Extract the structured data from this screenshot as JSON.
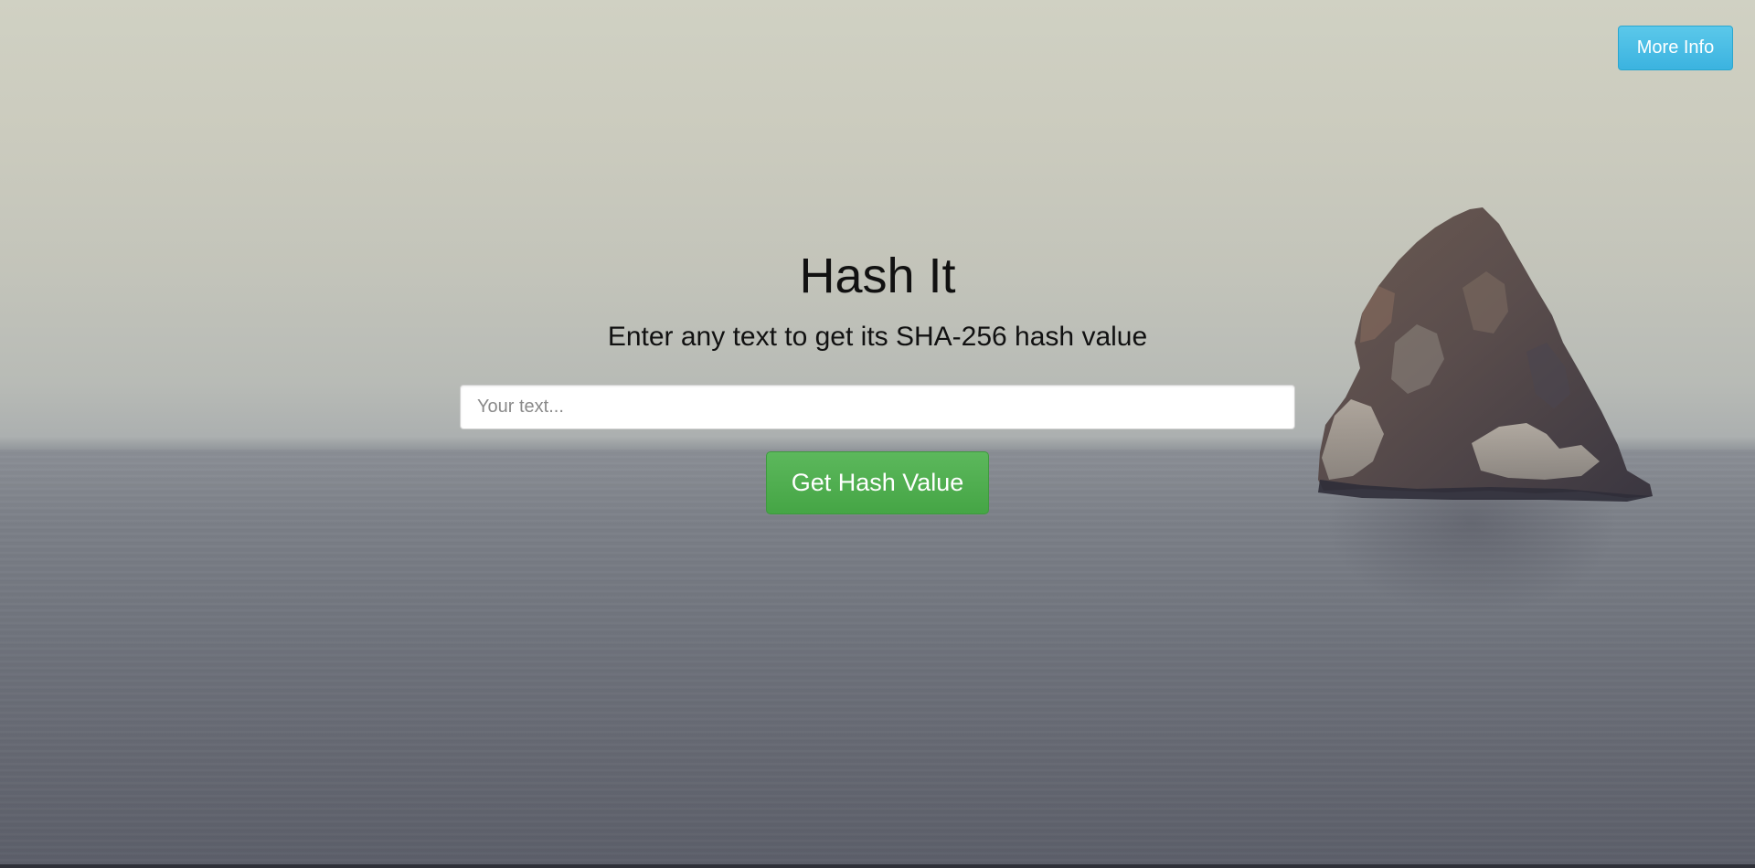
{
  "header": {
    "more_info_label": "More Info"
  },
  "hero": {
    "title": "Hash It",
    "subtitle": "Enter any text to get its SHA-256 hash value"
  },
  "form": {
    "input_placeholder": "Your text...",
    "input_value": "",
    "submit_label": "Get Hash Value"
  },
  "colors": {
    "info_button": "#3bb3e0",
    "submit_button": "#5cb85c",
    "text": "#111111"
  }
}
